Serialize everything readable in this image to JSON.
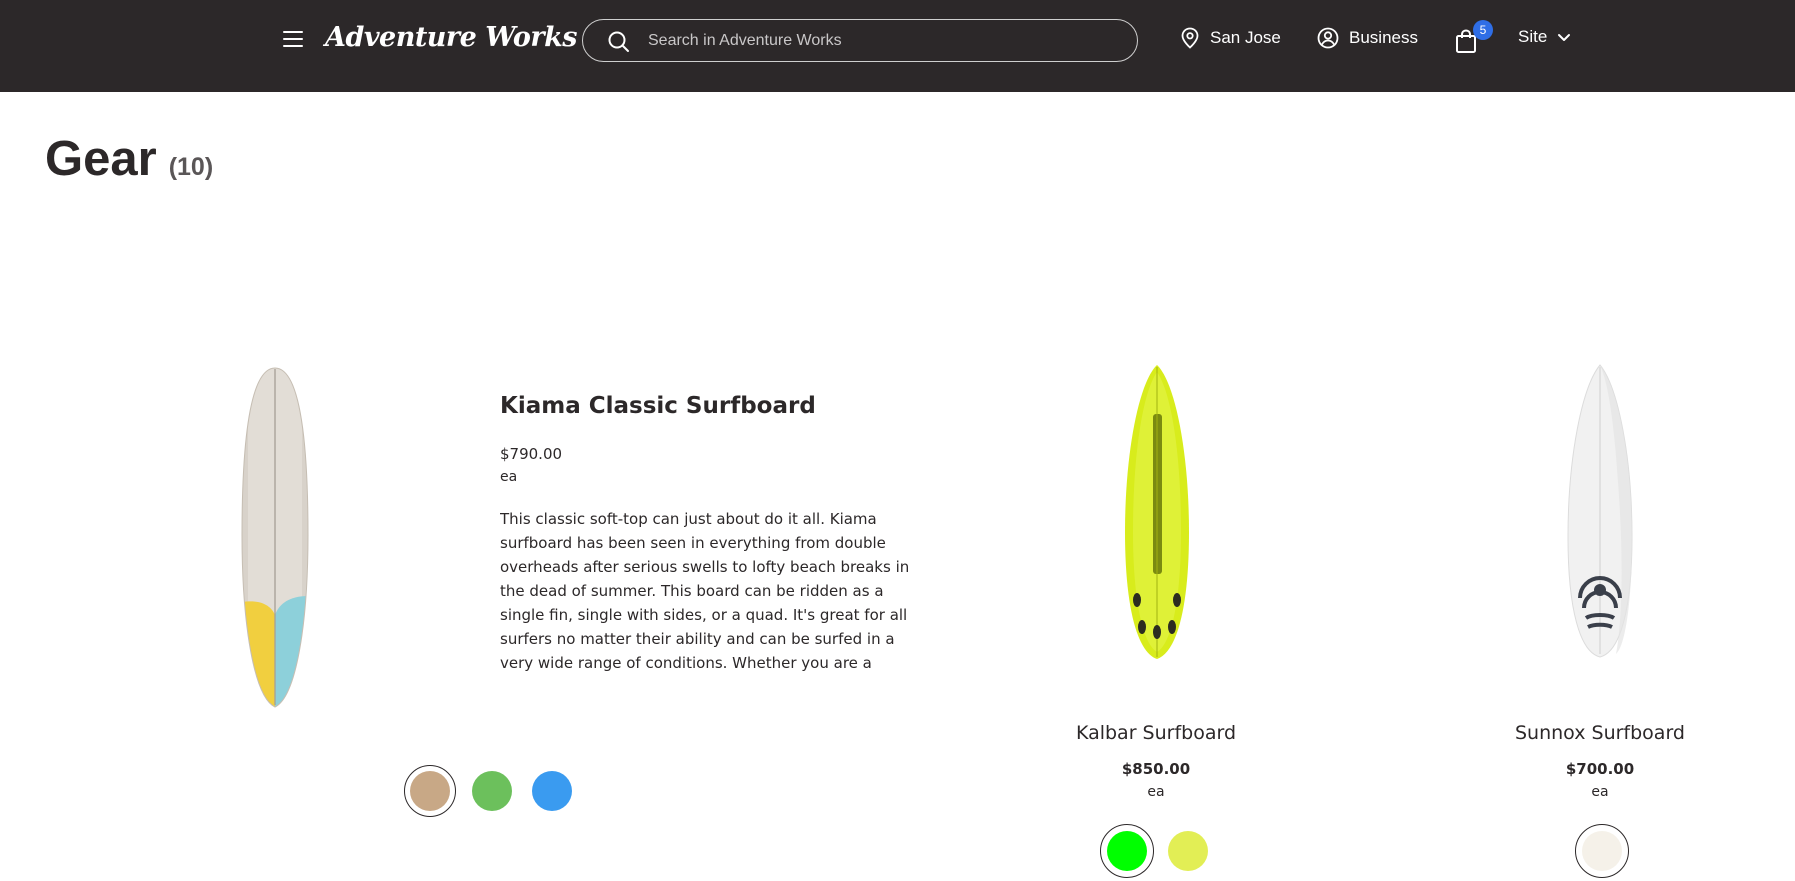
{
  "header": {
    "logo": "Adventure Works",
    "search_placeholder": "Search in Adventure Works",
    "location": "San Jose",
    "account": "Business",
    "cart_count": "5",
    "site": "Site"
  },
  "page": {
    "title": "Gear",
    "count": "(10)"
  },
  "featured": {
    "name": "Kiama Classic Surfboard",
    "price": "$790.00",
    "unit": "ea",
    "description": "This classic soft-top can just about do it all. Kiama surfboard has been seen in everything from double overheads after serious swells to lofty beach breaks in the dead of summer. This board can be ridden as a single fin, single with sides, or a quad. It's great for all surfers no matter their ability and can be surfed in a very wide range of conditions. Whether you are a youn...",
    "swatches": [
      "#c8a886",
      "#6cc05c",
      "#3a9bf0"
    ]
  },
  "products": [
    {
      "name": "Kalbar Surfboard",
      "price": "$850.00",
      "unit": "ea",
      "swatches": [
        "#00ff00",
        "#e2ee55"
      ]
    },
    {
      "name": "Sunnox Surfboard",
      "price": "$700.00",
      "unit": "ea",
      "swatches": [
        "#f5f1e9"
      ]
    }
  ],
  "icons": {
    "menu": "hamburger-icon",
    "search": "search-icon",
    "location": "map-pin-icon",
    "account": "user-circle-icon",
    "cart": "shopping-bag-icon",
    "site": "chevron-down-icon"
  }
}
